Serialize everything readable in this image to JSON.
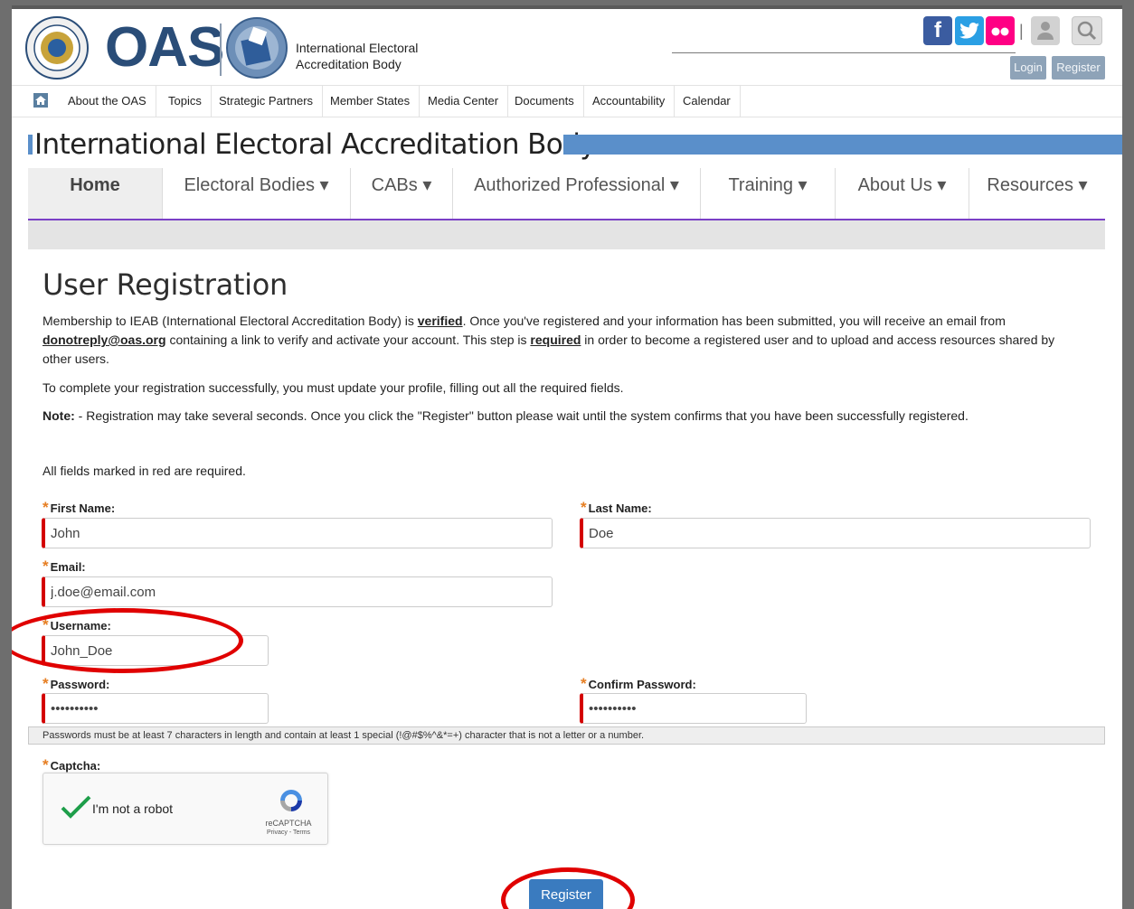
{
  "header": {
    "logo_text": "OAS",
    "logo_subtitle_line1": "International Electoral",
    "logo_subtitle_line2": "Accreditation Body",
    "social": {
      "facebook": "f",
      "twitter": "twitter-icon",
      "flickr": "flickr-icon"
    },
    "login_label": "Login",
    "register_label": "Register"
  },
  "topnav": {
    "items": [
      {
        "label": "About the OAS"
      },
      {
        "label": "Topics"
      },
      {
        "label": "Strategic Partners"
      },
      {
        "label": "Member States"
      },
      {
        "label": "Media Center"
      },
      {
        "label": "Documents"
      },
      {
        "label": "Accountability"
      },
      {
        "label": "Calendar"
      }
    ]
  },
  "site_title": "International Electoral Accreditation Body",
  "mainnav": {
    "items": [
      {
        "label": "Home"
      },
      {
        "label": "Electoral Bodies ▾"
      },
      {
        "label": "CABs ▾"
      },
      {
        "label": "Authorized Professional ▾"
      },
      {
        "label": "Training ▾"
      },
      {
        "label": "About Us ▾"
      },
      {
        "label": "Resources ▾"
      }
    ]
  },
  "content": {
    "heading": "User Registration",
    "p1_a": "Membership to IEAB (International Electoral Accreditation Body) is ",
    "p1_b": "verified",
    "p1_c": ". Once you've registered and your information has been submitted, you will receive an email from ",
    "p1_d": "donotreply@oas.org",
    "p1_e": " containing a link to verify and activate your account. This step is ",
    "p1_f": "required",
    "p1_g": " in order to become a registered user and to upload and access resources shared by other users.",
    "p2": "To complete your registration successfully, you must update your profile, filling out all the required fields.",
    "p3_label": "Note:",
    "p3": " - Registration may take several seconds. Once you click the \"Register\" button please wait until the system confirms that you have been successfully registered.",
    "required_note": "All fields marked in red are required."
  },
  "form": {
    "first_name": {
      "label": "First Name:",
      "value": "John"
    },
    "last_name": {
      "label": "Last Name:",
      "value": "Doe"
    },
    "email": {
      "label": "Email:",
      "value": "j.doe@email.com"
    },
    "username": {
      "label": "Username:",
      "value": "John_Doe"
    },
    "password": {
      "label": "Password:",
      "value": "••••••••••"
    },
    "confirm_password": {
      "label": "Confirm Password:",
      "value": "••••••••••"
    },
    "password_hint": "Passwords must be at least 7 characters in length and contain at least 1 special (!@#$%^&*=+) character that is not a letter or a number.",
    "captcha": {
      "label": "Captcha:",
      "checkbox_label": "I'm not a robot",
      "brand": "reCAPTCHA",
      "links": "Privacy - Terms"
    },
    "submit_label": "Register"
  },
  "colors": {
    "accent_blue": "#5a8fca",
    "nav_underline": "#7a3fc6",
    "required_red": "#d40000",
    "button_blue": "#3a7bbf",
    "annotation_red": "#e00000"
  }
}
